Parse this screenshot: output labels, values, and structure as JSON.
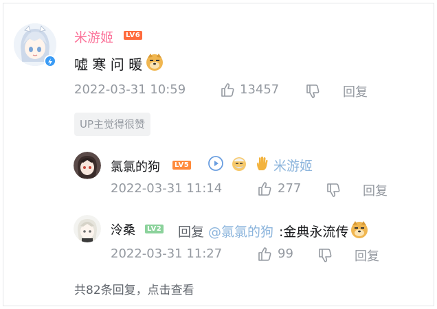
{
  "main_comment": {
    "user": "米游姬",
    "level": "LV6",
    "text": "嘘 寒 问 暖",
    "time": "2022-03-31 10:59",
    "likes": "13457",
    "reply_label": "回复",
    "up_badge": "UP主觉得很赞"
  },
  "replies": [
    {
      "user": "氯氯的狗",
      "level": "LV5",
      "mention": "米游姬",
      "time": "2022-03-31 11:14",
      "likes": "277",
      "reply_label": "回复"
    },
    {
      "user": "泠桑",
      "level": "LV2",
      "reply_prefix": "回复",
      "mention": "@氯氯的狗",
      "text": ":金典永流传",
      "time": "2022-03-31 11:27",
      "likes": "99",
      "reply_label": "回复"
    }
  ],
  "more_replies": "共82条回复，点击查看",
  "colors": {
    "vip_name": "#fb7299",
    "link": "#61666d",
    "mention": "#8bb4dc",
    "meta": "#9499a0",
    "lv6": "#ff6b3d",
    "lv5": "#ff8a3b",
    "lv2": "#8bd29b"
  }
}
